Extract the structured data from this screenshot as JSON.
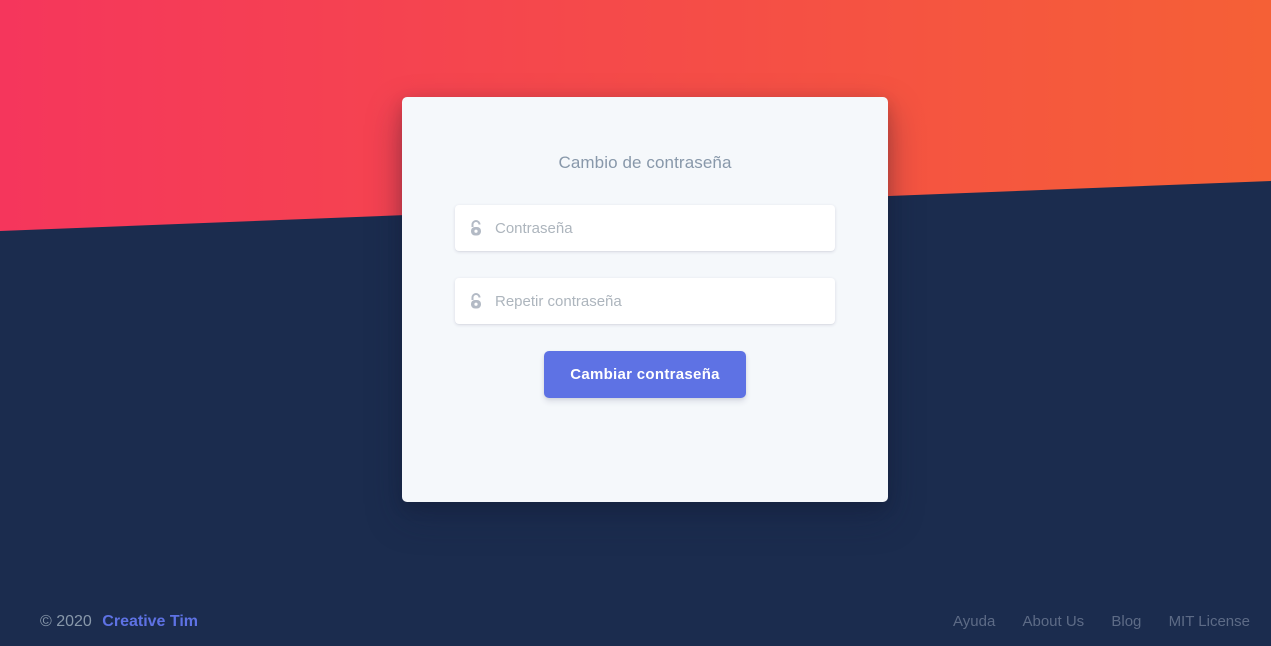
{
  "form": {
    "title": "Cambio de contraseña",
    "password_placeholder": "Contraseña",
    "password_value": "",
    "repeat_placeholder": "Repetir contraseña",
    "repeat_value": "",
    "submit_label": "Cambiar contraseña",
    "field_icon": "lock-open-icon"
  },
  "footer": {
    "copyright": "© 2020",
    "brand": "Creative Tim",
    "links": [
      "Ayuda",
      "About Us",
      "Blog",
      "MIT License"
    ]
  },
  "colors": {
    "gradient_start": "#f5365c",
    "gradient_end": "#f56036",
    "background": "#1b2c4e",
    "primary": "#5e72e4",
    "card": "#f5f8fb"
  }
}
